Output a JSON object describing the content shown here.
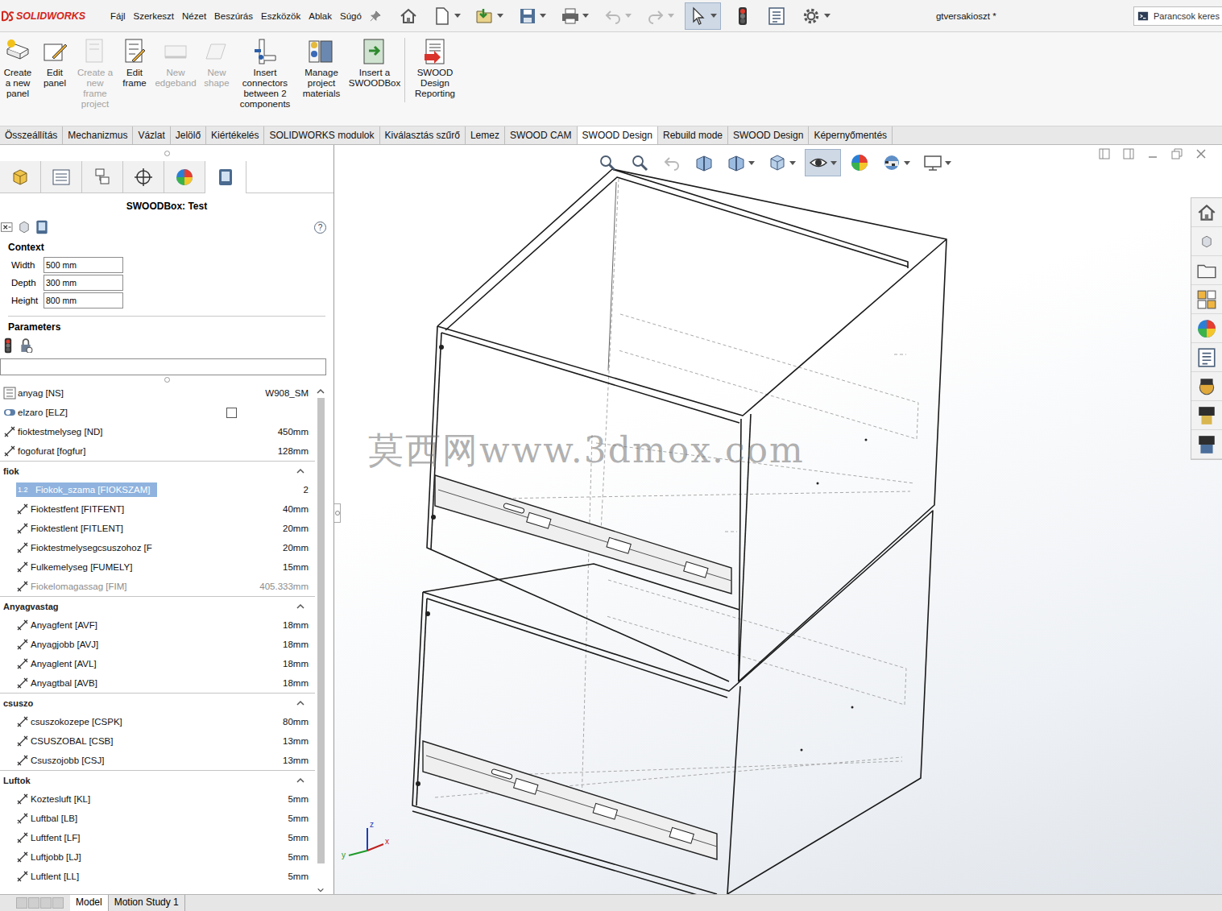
{
  "window": {
    "logo": "SOLIDWORKS",
    "title": "gtversakioszt *",
    "search": "Parancsok keres"
  },
  "menu": [
    "Fájl",
    "Szerkeszt",
    "Nézet",
    "Beszúrás",
    "Eszközök",
    "Ablak",
    "Súgó"
  ],
  "ribbon": [
    {
      "label": "Create a new panel",
      "disabled": false
    },
    {
      "label": "Edit panel",
      "disabled": false
    },
    {
      "label": "Create a new frame project",
      "disabled": true
    },
    {
      "label": "Edit frame",
      "disabled": false
    },
    {
      "label": "New edgeband",
      "disabled": true
    },
    {
      "label": "New shape",
      "disabled": true
    },
    {
      "label": "Insert connectors between 2 components",
      "disabled": false
    },
    {
      "label": "Manage project materials",
      "disabled": false
    },
    {
      "label": "Insert a SWOODBox",
      "disabled": false
    },
    {
      "label": "SWOOD Design Reporting",
      "disabled": false
    }
  ],
  "tabs": [
    {
      "label": "Összeállítás",
      "selected": false
    },
    {
      "label": "Mechanizmus",
      "selected": false
    },
    {
      "label": "Vázlat",
      "selected": false
    },
    {
      "label": "Jelölő",
      "selected": false
    },
    {
      "label": "Kiértékelés",
      "selected": false
    },
    {
      "label": "SOLIDWORKS modulok",
      "selected": false
    },
    {
      "label": "Kiválasztás szűrő",
      "selected": false
    },
    {
      "label": "Lemez",
      "selected": false
    },
    {
      "label": "SWOOD CAM",
      "selected": false
    },
    {
      "label": "SWOOD Design",
      "selected": true
    },
    {
      "label": "Rebuild mode",
      "selected": false
    },
    {
      "label": "SWOOD Design",
      "selected": false
    },
    {
      "label": "Képernyőmentés",
      "selected": false
    }
  ],
  "property_manager": {
    "title": "SWOODBox: Test",
    "help": "?",
    "context": {
      "heading": "Context",
      "fields": [
        {
          "label": "Width",
          "value": "500 mm"
        },
        {
          "label": "Depth",
          "value": "300 mm"
        },
        {
          "label": "Height",
          "value": "800 mm"
        }
      ]
    },
    "parameters": {
      "heading": "Parameters",
      "filter": ""
    },
    "items": [
      {
        "kind": "material",
        "label": "anyag [NS]",
        "value": "W908_SM",
        "selected": false,
        "disabled": false
      },
      {
        "kind": "checkbox",
        "label": "elzaro [ELZ]",
        "checked": false,
        "selected": false,
        "disabled": false
      },
      {
        "kind": "dimension",
        "label": "fioktestmelyseg [ND]",
        "value": "450mm",
        "selected": false,
        "disabled": false
      },
      {
        "kind": "dimension",
        "label": "fogofurat [fogfur]",
        "value": "128mm",
        "selected": false,
        "disabled": false
      }
    ],
    "groups": [
      {
        "title": "fiok",
        "expanded": true,
        "items": [
          {
            "kind": "number",
            "badge": "1.2",
            "label": "Fiokok_szama [FIOKSZAM]",
            "value": "2",
            "selected": true,
            "disabled": false
          },
          {
            "kind": "dimension",
            "label": "Fioktestfent [FITFENT]",
            "value": "40mm",
            "selected": false,
            "disabled": false
          },
          {
            "kind": "dimension",
            "label": "Fioktestlent [FITLENT]",
            "value": "20mm",
            "selected": false,
            "disabled": false
          },
          {
            "kind": "dimension",
            "label": "Fioktestmelysegcsuszohoz [F",
            "value": "20mm",
            "selected": false,
            "disabled": false
          },
          {
            "kind": "dimension",
            "label": "Fulkemelyseg [FUMELY]",
            "value": "15mm",
            "selected": false,
            "disabled": false
          },
          {
            "kind": "dimension",
            "label": "Fiokelomagassag [FIM]",
            "value": "405.333mm",
            "selected": false,
            "disabled": true
          }
        ]
      },
      {
        "title": "Anyagvastag",
        "expanded": true,
        "items": [
          {
            "kind": "dimension",
            "label": "Anyagfent [AVF]",
            "value": "18mm",
            "selected": false,
            "disabled": false
          },
          {
            "kind": "dimension",
            "label": "Anyagjobb [AVJ]",
            "value": "18mm",
            "selected": false,
            "disabled": false
          },
          {
            "kind": "dimension",
            "label": "Anyaglent [AVL]",
            "value": "18mm",
            "selected": false,
            "disabled": false
          },
          {
            "kind": "dimension",
            "label": "Anyagtbal [AVB]",
            "value": "18mm",
            "selected": false,
            "disabled": false
          }
        ]
      },
      {
        "title": "csuszo",
        "expanded": true,
        "items": [
          {
            "kind": "dimension",
            "label": "csuszokozepe [CSPK]",
            "value": "80mm",
            "selected": false,
            "disabled": false
          },
          {
            "kind": "dimension",
            "label": "CSUSZOBAL [CSB]",
            "value": "13mm",
            "selected": false,
            "disabled": false
          },
          {
            "kind": "dimension",
            "label": "Csuszojobb [CSJ]",
            "value": "13mm",
            "selected": false,
            "disabled": false
          }
        ]
      },
      {
        "title": "Luftok",
        "expanded": true,
        "items": [
          {
            "kind": "dimension",
            "label": "Koztesluft [KL]",
            "value": "5mm",
            "selected": false,
            "disabled": false
          },
          {
            "kind": "dimension",
            "label": "Luftbal [LB]",
            "value": "5mm",
            "selected": false,
            "disabled": false
          },
          {
            "kind": "dimension",
            "label": "Luftfent [LF]",
            "value": "5mm",
            "selected": false,
            "disabled": false
          },
          {
            "kind": "dimension",
            "label": "Luftjobb [LJ]",
            "value": "5mm",
            "selected": false,
            "disabled": false
          },
          {
            "kind": "dimension",
            "label": "Luftlent [LL]",
            "value": "5mm",
            "selected": false,
            "disabled": false
          }
        ]
      }
    ]
  },
  "watermark": "莫西网www.3dmox.com",
  "axes": {
    "x": "x",
    "y": "y",
    "z": "z"
  },
  "bottom_tabs": [
    {
      "label": "Model",
      "selected": true
    },
    {
      "label": "Motion Study 1",
      "selected": false
    }
  ]
}
